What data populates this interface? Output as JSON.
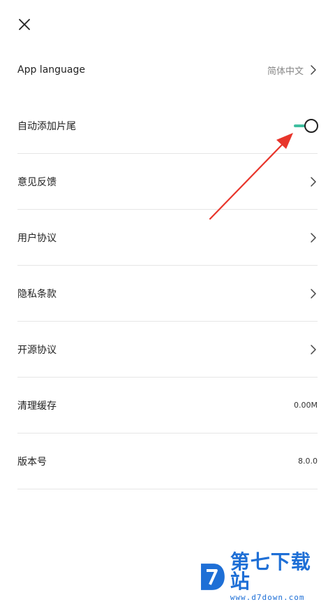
{
  "settings": {
    "rows": [
      {
        "label": "App language",
        "value": "简体中文"
      },
      {
        "label": "自动添加片尾"
      },
      {
        "label": "意见反馈"
      },
      {
        "label": "用户协议"
      },
      {
        "label": "隐私条款"
      },
      {
        "label": "开源协议"
      },
      {
        "label": "清理缓存",
        "value": "0.00M"
      },
      {
        "label": "版本号",
        "value": "8.0.0"
      }
    ],
    "auto_outro_enabled": true
  },
  "icons": {
    "close": "close-icon",
    "chevron": "chevron-right-icon"
  },
  "colors": {
    "toggle_accent": "#3fbfa0",
    "annotation_arrow": "#e8352b",
    "watermark_blue": "#1e6fd6"
  },
  "watermark": {
    "title": "第七下载站",
    "url": "www.d7down.com"
  }
}
